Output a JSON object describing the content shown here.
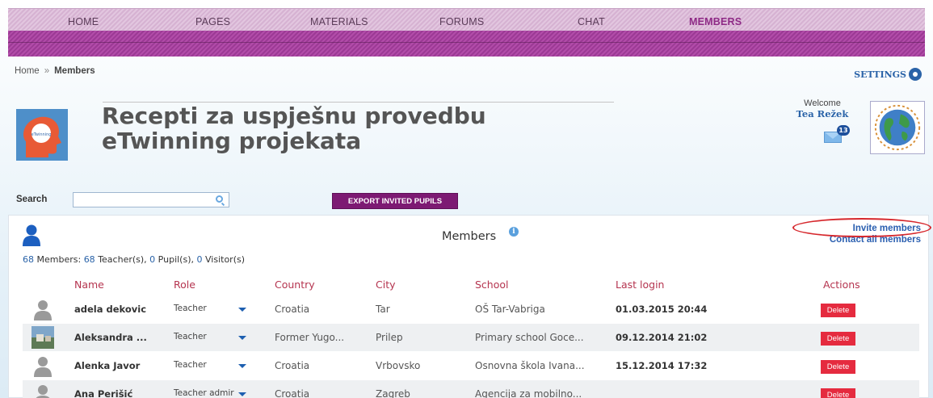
{
  "nav": {
    "items": [
      "HOME",
      "PAGES",
      "MATERIALS",
      "FORUMS",
      "CHAT",
      "MEMBERS"
    ],
    "active": "MEMBERS"
  },
  "breadcrumb": {
    "home": "Home",
    "separator": "»",
    "current": "Members"
  },
  "settings": {
    "label": "SETTINGS"
  },
  "project": {
    "title_line1": "Recepti za uspješnu provedbu",
    "title_line2": "eTwinning projekata"
  },
  "welcome": {
    "label": "Welcome",
    "user": "Tea Režek",
    "message_count": "13"
  },
  "search": {
    "label": "Search",
    "value": "",
    "placeholder": ""
  },
  "export_button": "EXPORT INVITED PUPILS",
  "panel": {
    "title": "Members",
    "invite": "Invite members",
    "contact": "Contact all members",
    "summary": {
      "members_count": "68",
      "members_label": "Members:",
      "teachers_count": "68",
      "teachers_label": "Teacher(s),",
      "pupils_count": "0",
      "pupils_label": "Pupil(s),",
      "visitors_count": "0",
      "visitors_label": "Visitor(s)"
    }
  },
  "table": {
    "headers": [
      "Name",
      "Role",
      "Country",
      "City",
      "School",
      "Last login",
      "Actions"
    ],
    "rows": [
      {
        "name": "adela dekovic",
        "role": "Teacher",
        "country": "Croatia",
        "city": "Tar",
        "school": "OŠ Tar-Vabriga",
        "last_login": "01.03.2015 20:44",
        "action": "Delete",
        "avatar": "default-avatar"
      },
      {
        "name": "Aleksandra ...",
        "role": "Teacher",
        "country": "Former Yugo...",
        "city": "Prilep",
        "school": "Primary school Goce...",
        "last_login": "09.12.2014 21:02",
        "action": "Delete",
        "avatar": "photo-avatar"
      },
      {
        "name": "Alenka Javor",
        "role": "Teacher",
        "country": "Croatia",
        "city": "Vrbovsko",
        "school": "Osnovna škola Ivana...",
        "last_login": "15.12.2014 17:32",
        "action": "Delete",
        "avatar": "default-avatar"
      },
      {
        "name": "Ana Perišić",
        "role": "Teacher admir",
        "country": "Croatia",
        "city": "Zagreb",
        "school": "Agencija za mobilno...",
        "last_login": "",
        "action": "Delete",
        "avatar": "default-avatar"
      }
    ]
  },
  "colors": {
    "nav_light": "#e2c6df",
    "nav_dark": "#9c3a95",
    "accent_purple": "#7d1a73",
    "link_blue": "#2a63a8",
    "header_red": "#b5344f",
    "delete_red": "#e52b3f",
    "highlight_red": "#d6272c"
  }
}
